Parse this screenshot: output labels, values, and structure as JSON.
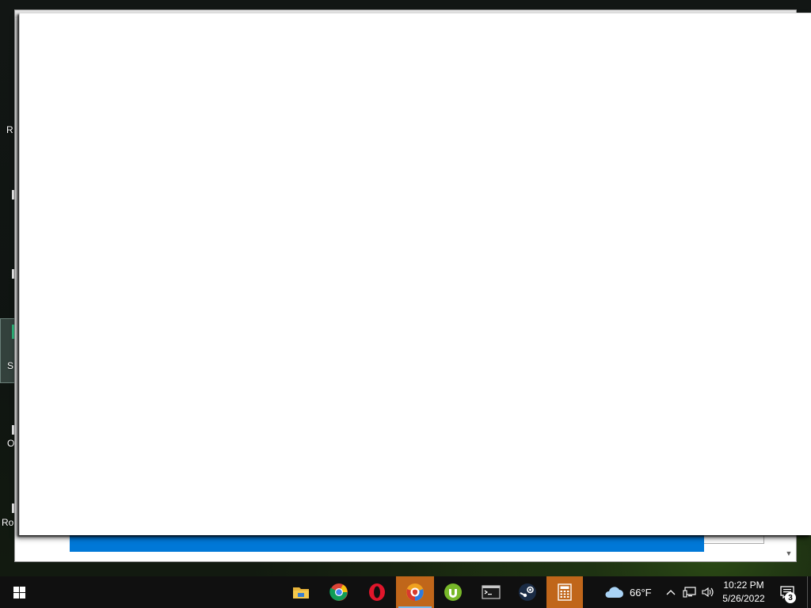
{
  "desktop": {
    "icon_labels": [
      "R",
      "S",
      "O",
      "Ro"
    ]
  },
  "background_window": {
    "scroll_down_glyph": "▼"
  },
  "taskbar": {
    "start_icon": "windows-logo-icon",
    "apps": [
      {
        "name": "File Explorer",
        "icon": "folder-icon",
        "active": false
      },
      {
        "name": "Google Chrome",
        "icon": "chrome-icon",
        "active": false
      },
      {
        "name": "Opera",
        "icon": "opera-icon",
        "active": false
      },
      {
        "name": "Security Browser",
        "icon": "shield-browser-icon",
        "active": true
      },
      {
        "name": "uTorrent",
        "icon": "utorrent-icon",
        "active": false
      },
      {
        "name": "Command Prompt",
        "icon": "terminal-icon",
        "active": false
      },
      {
        "name": "Steam",
        "icon": "steam-icon",
        "active": false
      },
      {
        "name": "Calculator",
        "icon": "calculator-icon",
        "active": true
      }
    ],
    "weather": {
      "temperature": "66°F",
      "icon": "cloud-icon"
    },
    "tray_icons": [
      "chevron-up-icon",
      "network-icon",
      "volume-icon"
    ],
    "clock": {
      "time": "10:22 PM",
      "date": "5/26/2022"
    },
    "notifications": {
      "count": "3",
      "icon": "action-center-icon"
    }
  }
}
